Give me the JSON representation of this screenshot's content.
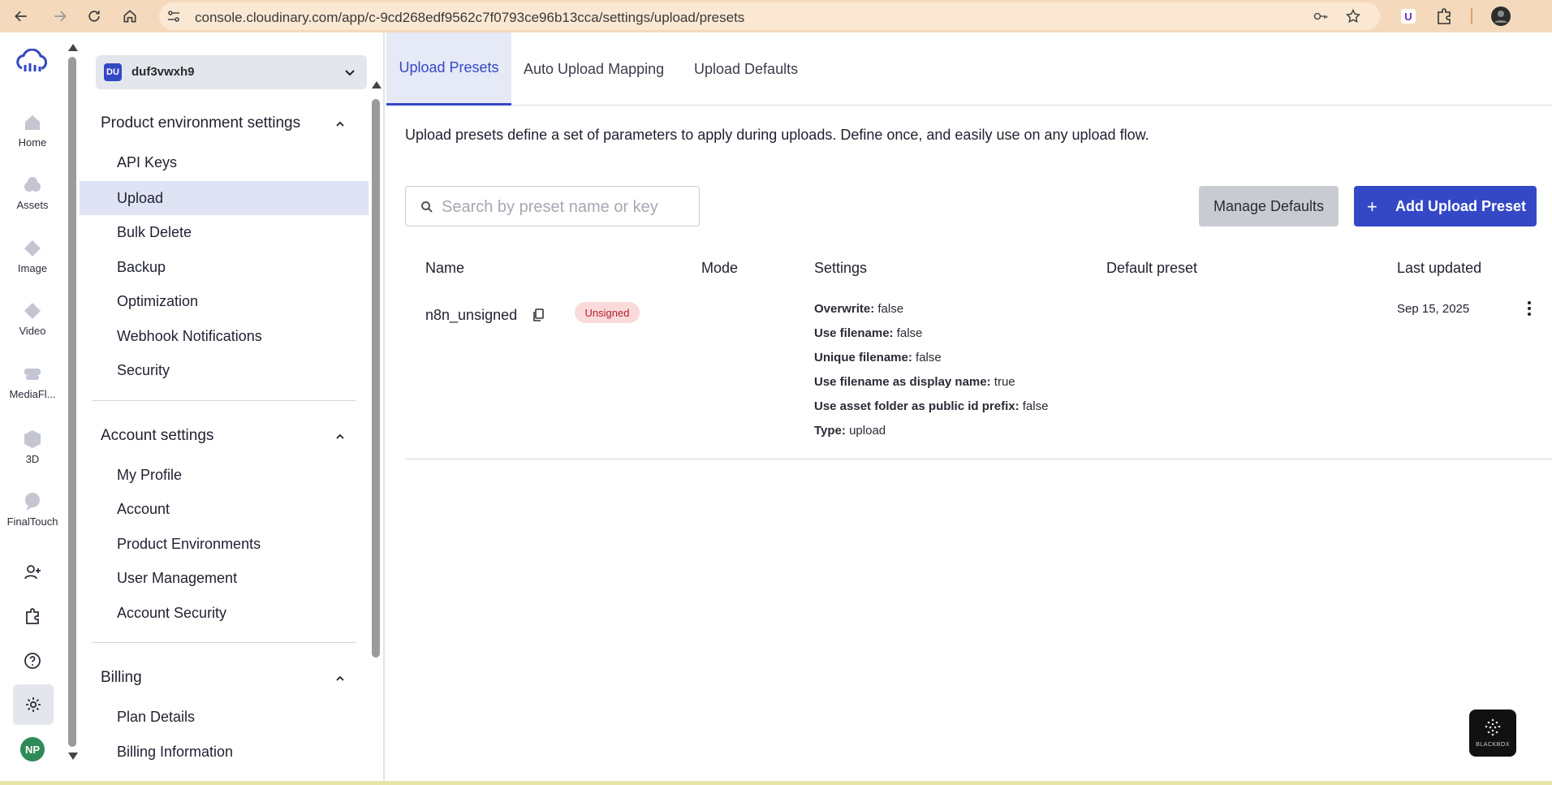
{
  "browser": {
    "url": "console.cloudinary.com/app/c-9cd268edf9562c7f0793ce96b13cca/settings/upload/presets"
  },
  "rail": {
    "items": [
      {
        "label": "Home",
        "icon": "home-icon"
      },
      {
        "label": "Assets",
        "icon": "assets-icon"
      },
      {
        "label": "Image",
        "icon": "image-icon"
      },
      {
        "label": "Video",
        "icon": "video-icon"
      },
      {
        "label": "MediaFl...",
        "icon": "mediaflows-icon"
      },
      {
        "label": "3D",
        "icon": "cube-icon"
      },
      {
        "label": "FinalTouch",
        "icon": "finaltouch-icon"
      }
    ],
    "avatar": "NP"
  },
  "sidebar": {
    "environment": {
      "badge": "DU",
      "name": "duf3vwxh9"
    },
    "sections": [
      {
        "title": "Product environment settings",
        "items": [
          "API Keys",
          "Upload",
          "Bulk Delete",
          "Backup",
          "Optimization",
          "Webhook Notifications",
          "Security"
        ],
        "active": "Upload"
      },
      {
        "title": "Account settings",
        "items": [
          "My Profile",
          "Account",
          "Product Environments",
          "User Management",
          "Account Security"
        ]
      },
      {
        "title": "Billing",
        "items": [
          "Plan Details",
          "Billing Information"
        ]
      }
    ]
  },
  "main": {
    "tabs": [
      "Upload Presets",
      "Auto Upload Mapping",
      "Upload Defaults"
    ],
    "active_tab": "Upload Presets",
    "intro": "Upload presets define a set of parameters to apply during uploads. Define once, and easily use on any upload flow.",
    "search": {
      "placeholder": "Search by preset name or key",
      "value": ""
    },
    "manage_defaults_label": "Manage Defaults",
    "add_preset_label": "Add Upload Preset",
    "table": {
      "headers": [
        "Name",
        "Mode",
        "Settings",
        "Default preset",
        "Last updated"
      ],
      "rows": [
        {
          "name": "n8n_unsigned",
          "mode": "Unsigned",
          "settings": [
            {
              "key": "Overwrite:",
              "value": "false"
            },
            {
              "key": "Use filename:",
              "value": "false"
            },
            {
              "key": "Unique filename:",
              "value": "false"
            },
            {
              "key": "Use filename as display name:",
              "value": "true"
            },
            {
              "key": "Use asset folder as public id prefix:",
              "value": "false"
            },
            {
              "key": "Type:",
              "value": "upload"
            }
          ],
          "default_preset": "",
          "last_updated": "Sep 15, 2025"
        }
      ]
    }
  },
  "widget": {
    "label": "BLACKBOX"
  },
  "colors": {
    "accent": "#3448c5",
    "browser_bar": "#f4d9bd",
    "active_nav": "#dfe3f4",
    "unsigned_badge_bg": "#fbdada",
    "unsigned_badge_text": "#b4202a"
  }
}
